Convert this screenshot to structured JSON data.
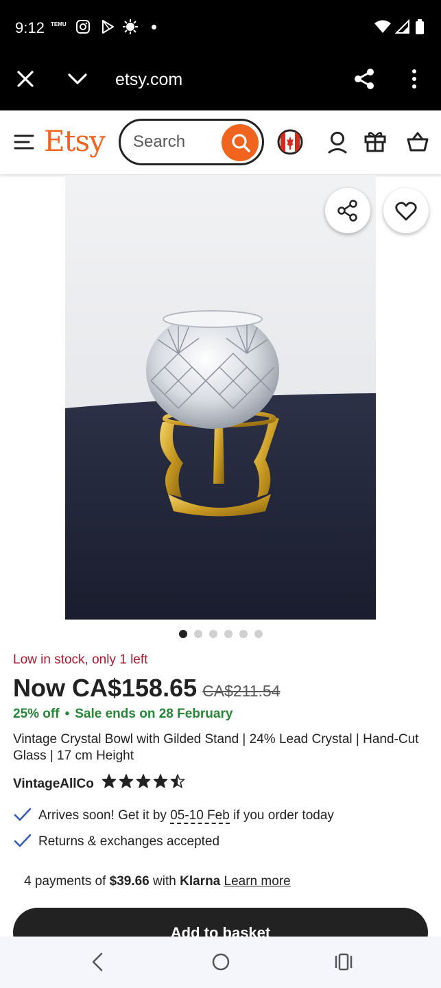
{
  "status_bar": {
    "time": "9:12",
    "temu_label": "TEMU",
    "icons": [
      "temu-icon",
      "instagram-icon",
      "play-store-icon",
      "settings-sun-icon",
      "notification-dot",
      "wifi-icon",
      "signal-icon",
      "battery-icon"
    ]
  },
  "browser": {
    "url": "etsy.com",
    "icons": [
      "close-icon",
      "chevron-down-icon",
      "share-icon",
      "more-vert-icon"
    ]
  },
  "etsy_header": {
    "logo": "Etsy",
    "search_placeholder": "Search",
    "icons": [
      "menu-icon",
      "search-icon",
      "canada-flag-icon",
      "account-icon",
      "gift-icon",
      "basket-icon"
    ],
    "brand_color": "#f1641e"
  },
  "product": {
    "image_pages": 6,
    "active_page": 1,
    "low_stock": "Low in stock, only 1 left",
    "price_now": "Now CA$158.65",
    "price_old": "CA$211.54",
    "discount": "25% off",
    "separator": "•",
    "sale_ends": "Sale ends on 28 February",
    "title": "Vintage Crystal Bowl with Gilded Stand | 24% Lead Crystal | Hand-Cut Glass | 17 cm Height",
    "seller": "VintageAllCo",
    "rating_stars": 4.5,
    "arrival_prefix": "Arrives soon! Get it by ",
    "arrival_date": "05-10 Feb",
    "arrival_suffix": " if you order today",
    "returns": "Returns & exchanges accepted",
    "klarna_prefix": "4 payments of ",
    "klarna_amount": "$39.66",
    "klarna_with": " with ",
    "klarna_brand": "Klarna",
    "klarna_learn": "Learn more",
    "add_to_basket": "Add to basket",
    "low_stock_color": "#a61a2e",
    "sale_color": "#258635"
  },
  "nav_bar": {
    "icons": [
      "back-icon",
      "home-icon",
      "recents-icon"
    ]
  }
}
